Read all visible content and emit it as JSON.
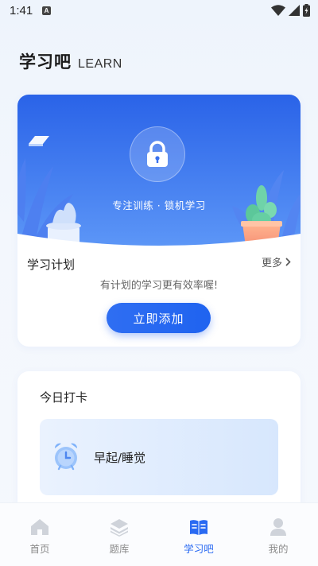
{
  "status_bar": {
    "time": "1:41",
    "notification_badge": "A"
  },
  "header": {
    "title": "学习吧",
    "subtitle": "LEARN"
  },
  "study_card": {
    "banner_text": "专注训练 · 锁机学习",
    "plan_title": "学习计划",
    "more_label": "更多",
    "description": "有计划的学习更有效率喔!",
    "add_button_label": "立即添加"
  },
  "checkin_card": {
    "title": "今日打卡",
    "items": [
      {
        "label": "早起/睡觉",
        "icon": "alarm-clock-icon"
      }
    ]
  },
  "tab_bar": {
    "active_index": 2,
    "tabs": [
      {
        "label": "首页",
        "icon": "home-icon"
      },
      {
        "label": "题库",
        "icon": "layers-icon"
      },
      {
        "label": "学习吧",
        "icon": "book-icon"
      },
      {
        "label": "我的",
        "icon": "user-icon"
      }
    ]
  },
  "colors": {
    "accent": "#2a6af2",
    "banner_top": "#2a63e8",
    "banner_bottom": "#5d97f7"
  }
}
